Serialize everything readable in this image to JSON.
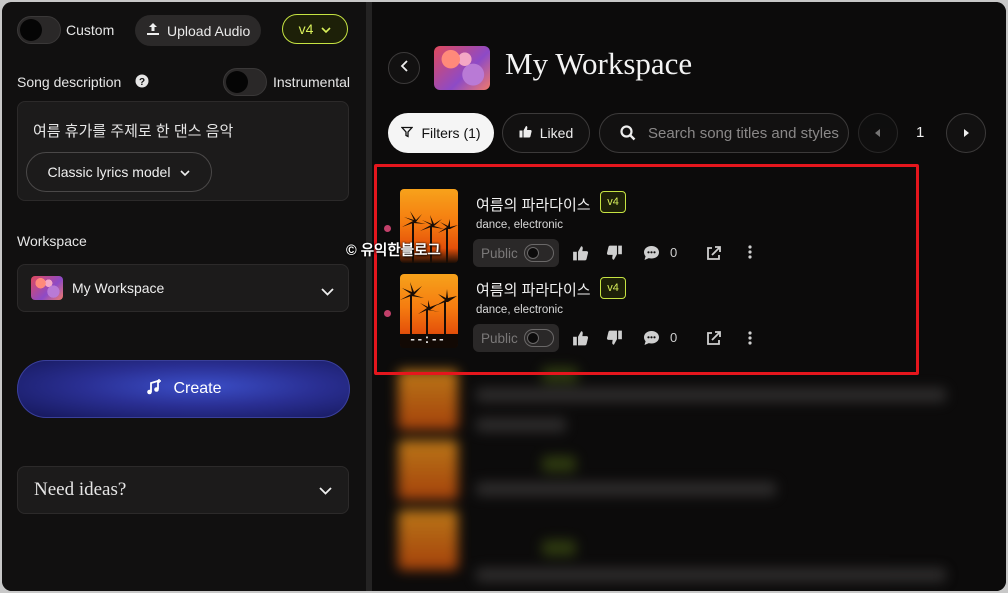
{
  "sidebar": {
    "custom_label": "Custom",
    "upload_label": "Upload Audio",
    "model_version": "v4",
    "song_description_label": "Song description",
    "instrumental_label": "Instrumental",
    "description_value": "여름 휴가를 주제로 한 댄스 음악",
    "lyrics_model_label": "Classic lyrics model",
    "workspace_label": "Workspace",
    "workspace_value": "My Workspace",
    "create_label": "Create",
    "need_ideas_label": "Need ideas?"
  },
  "main": {
    "title": "My Workspace",
    "filters_label": "Filters (1)",
    "liked_label": "Liked",
    "search_placeholder": "Search song titles and styles",
    "page_number": "1",
    "songs": [
      {
        "title": "여름의 파라다이스",
        "version": "v4",
        "tags": "dance, electronic",
        "visibility": "Public",
        "comments": "0"
      },
      {
        "title": "여름의 파라다이스",
        "version": "v4",
        "tags": "dance, electronic",
        "visibility": "Public",
        "comments": "0",
        "time_display": "--:--"
      }
    ]
  },
  "watermark": "© 유익한블로그",
  "colors": {
    "accent_lime": "#c6e342",
    "create_blue": "#2a2f93",
    "highlight_red": "#e5161d"
  }
}
